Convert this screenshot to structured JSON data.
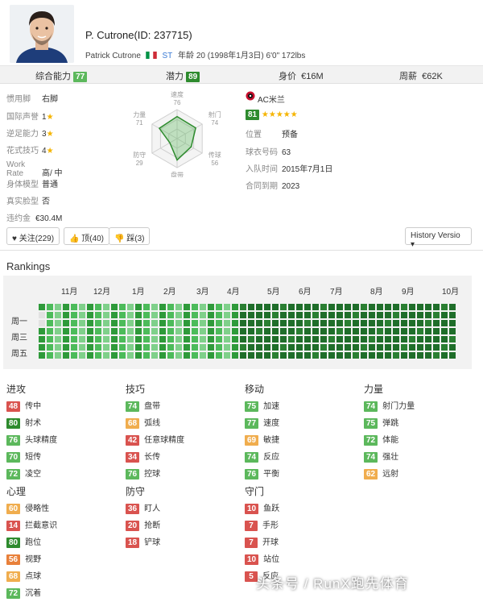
{
  "player": {
    "name": "P. Cutrone(ID: 237715)",
    "full_name": "Patrick Cutrone",
    "position": "ST",
    "age_line": "年龄 20 (1998年1月3日) 6'0\" 172lbs"
  },
  "ratings": {
    "overall_label": "综合能力",
    "overall": "77",
    "potential_label": "潜力",
    "potential": "89",
    "value_label": "身价",
    "value": "€16M",
    "wage_label": "周薪",
    "wage": "€62K"
  },
  "info": {
    "foot_k": "惯用脚",
    "foot_v": "右脚",
    "rep_k": "国际声誉",
    "rep_v": "1",
    "weak_k": "逆足能力",
    "weak_v": "3",
    "skill_k": "花式技巧",
    "skill_v": "4",
    "wr_k": "Work Rate",
    "wr_v": "高/ 中",
    "body_k": "身体模型",
    "body_v": "普通",
    "face_k": "真实脸型",
    "face_v": "否",
    "release_k": "违约金",
    "release_v": "€30.4M"
  },
  "radar": {
    "labels": [
      "速度",
      "射门",
      "传球",
      "盘带",
      "防守",
      "力量"
    ],
    "values": [
      "76",
      "74",
      "56",
      "74",
      "29",
      "71"
    ]
  },
  "club": {
    "name": "AC米兰",
    "rating": "81",
    "pos_k": "位置",
    "pos_v": "预备",
    "num_k": "球衣号码",
    "num_v": "63",
    "join_k": "入队时间",
    "join_v": "2015年7月1日",
    "contract_k": "合同到期",
    "contract_v": "2023"
  },
  "buttons": {
    "follow": "关注(229)",
    "like": "顶(40)",
    "dislike": "踩(3)",
    "history": "History Versio"
  },
  "rankings": {
    "title": "Rankings",
    "months": [
      "11月",
      "12月",
      "1月",
      "2月",
      "3月",
      "4月",
      "5月",
      "6月",
      "7月",
      "8月",
      "9月",
      "10月"
    ],
    "days": [
      "周一",
      "周三",
      "周五"
    ]
  },
  "attributes": {
    "attack": {
      "title": "进攻",
      "items": [
        {
          "v": "48",
          "n": "传中"
        },
        {
          "v": "80",
          "n": "射术"
        },
        {
          "v": "76",
          "n": "头球精度"
        },
        {
          "v": "70",
          "n": "短传"
        },
        {
          "v": "72",
          "n": "凌空"
        }
      ]
    },
    "skill": {
      "title": "技巧",
      "items": [
        {
          "v": "74",
          "n": "盘带"
        },
        {
          "v": "68",
          "n": "弧线"
        },
        {
          "v": "42",
          "n": "任意球精度"
        },
        {
          "v": "34",
          "n": "长传"
        },
        {
          "v": "76",
          "n": "控球"
        }
      ]
    },
    "movement": {
      "title": "移动",
      "items": [
        {
          "v": "75",
          "n": "加速"
        },
        {
          "v": "77",
          "n": "速度"
        },
        {
          "v": "69",
          "n": "敏捷"
        },
        {
          "v": "74",
          "n": "反应"
        },
        {
          "v": "76",
          "n": "平衡"
        }
      ]
    },
    "power": {
      "title": "力量",
      "items": [
        {
          "v": "74",
          "n": "射门力量"
        },
        {
          "v": "75",
          "n": "弹跳"
        },
        {
          "v": "72",
          "n": "体能"
        },
        {
          "v": "74",
          "n": "强壮"
        },
        {
          "v": "62",
          "n": "远射"
        }
      ]
    },
    "mentality": {
      "title": "心理",
      "items": [
        {
          "v": "60",
          "n": "侵略性"
        },
        {
          "v": "14",
          "n": "拦截意识"
        },
        {
          "v": "80",
          "n": "跑位"
        },
        {
          "v": "56",
          "n": "视野"
        },
        {
          "v": "68",
          "n": "点球"
        },
        {
          "v": "72",
          "n": "沉着"
        }
      ]
    },
    "defending": {
      "title": "防守",
      "items": [
        {
          "v": "36",
          "n": "盯人"
        },
        {
          "v": "20",
          "n": "抢断"
        },
        {
          "v": "18",
          "n": "铲球"
        }
      ]
    },
    "goalkeeping": {
      "title": "守门",
      "items": [
        {
          "v": "10",
          "n": "鱼跃"
        },
        {
          "v": "7",
          "n": "手形"
        },
        {
          "v": "7",
          "n": "开球"
        },
        {
          "v": "10",
          "n": "站位"
        },
        {
          "v": "5",
          "n": "反应"
        }
      ]
    }
  },
  "watermark": "头条号 / RunX跑先体育",
  "colors": {
    "accent_green": "#2e8b2e",
    "light_green": "#5cb85c",
    "orange": "#f0ad4e",
    "red": "#d9534f"
  }
}
